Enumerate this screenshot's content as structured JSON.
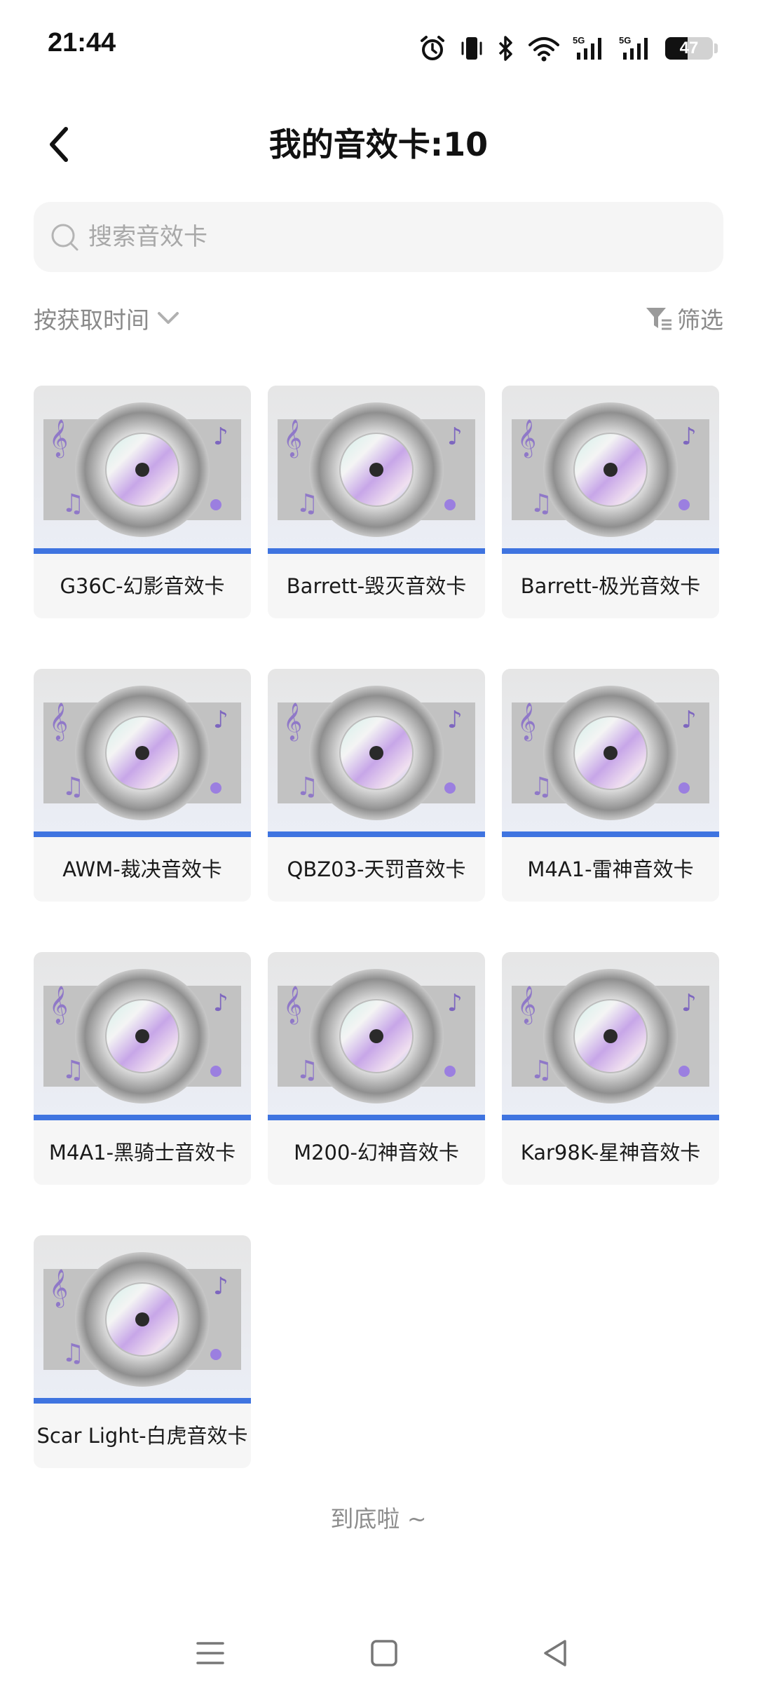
{
  "status_bar": {
    "time": "21:44",
    "battery_level": "47",
    "icons": [
      "alarm-icon",
      "vibrate-icon",
      "bluetooth-icon",
      "wifi-icon",
      "signal-5g-icon",
      "signal-5g-icon",
      "battery-icon"
    ]
  },
  "header": {
    "title": "我的音效卡:10",
    "back_icon": "chevron-left-icon"
  },
  "search": {
    "placeholder": "搜索音效卡",
    "value": ""
  },
  "sort": {
    "label": "按获取时间",
    "icon": "chevron-down-icon"
  },
  "filter": {
    "label": "筛选",
    "icon": "filter-icon"
  },
  "cards": [
    {
      "label": "G36C-幻影音效卡"
    },
    {
      "label": "Barrett-毁灭音效卡"
    },
    {
      "label": "Barrett-极光音效卡"
    },
    {
      "label": "AWM-裁决音效卡"
    },
    {
      "label": "QBZ03-天罚音效卡"
    },
    {
      "label": "M4A1-雷神音效卡"
    },
    {
      "label": "M4A1-黑骑士音效卡"
    },
    {
      "label": "M200-幻神音效卡"
    },
    {
      "label": "Kar98K-星神音效卡"
    },
    {
      "label": "Scar Light-白虎音效卡"
    }
  ],
  "end_text": "到底啦 ~",
  "nav_bar": {
    "icons": [
      "menu-icon",
      "home-icon",
      "back-icon"
    ]
  },
  "colors": {
    "card_background": "#f6f6f6",
    "accent_blue": "#3f74e0",
    "disc_purple": "#9b7fe0"
  }
}
